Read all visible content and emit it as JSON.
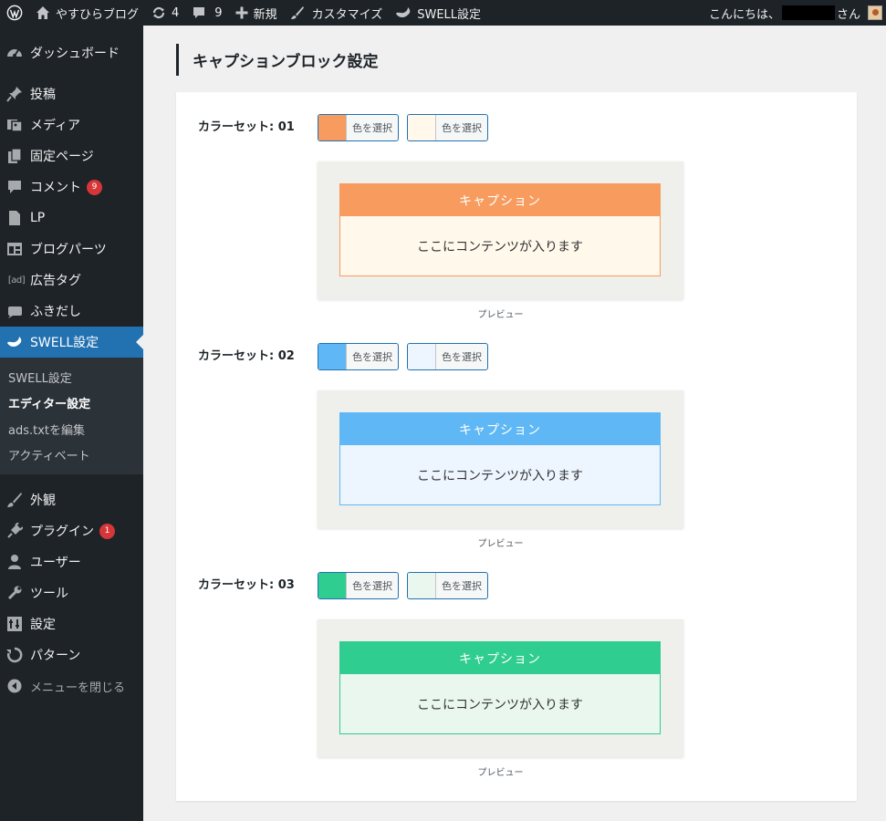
{
  "adminbar": {
    "site_name": "やすひらブログ",
    "updates_count": "4",
    "comments_count": "9",
    "new_label": "新規",
    "customize_label": "カスタマイズ",
    "swell_label": "SWELL設定",
    "greeting_prefix": "こんにちは、",
    "greeting_suffix": "さん"
  },
  "sidebar": {
    "items_top": [
      {
        "label": "ダッシュボード",
        "icon": "dashboard-icon"
      },
      {
        "label": "投稿",
        "icon": "pin-icon"
      },
      {
        "label": "メディア",
        "icon": "media-icon"
      },
      {
        "label": "固定ページ",
        "icon": "page-icon"
      },
      {
        "label": "コメント",
        "icon": "comment-icon",
        "badge": "9"
      },
      {
        "label": "LP",
        "icon": "lp-icon"
      },
      {
        "label": "ブログパーツ",
        "icon": "blog-parts-icon"
      },
      {
        "label": "広告タグ",
        "icon": "ad-icon",
        "icon_text": "[ad]"
      },
      {
        "label": "ふきだし",
        "icon": "balloon-icon"
      },
      {
        "label": "SWELL設定",
        "icon": "swell-icon"
      }
    ],
    "submenu": [
      "SWELL設定",
      "エディター設定",
      "ads.txtを編集",
      "アクティベート"
    ],
    "items_bottom": [
      {
        "label": "外観",
        "icon": "brush-icon"
      },
      {
        "label": "プラグイン",
        "icon": "plugin-icon",
        "badge": "1"
      },
      {
        "label": "ユーザー",
        "icon": "user-icon"
      },
      {
        "label": "ツール",
        "icon": "wrench-icon"
      },
      {
        "label": "設定",
        "icon": "settings-icon"
      },
      {
        "label": "パターン",
        "icon": "pattern-icon"
      }
    ],
    "collapse_label": "メニューを閉じる"
  },
  "main": {
    "title": "キャプションブロック設定",
    "color_button_label": "色を選択",
    "sets": [
      {
        "label": "カラーセット: 01",
        "color1": "#f79b5e",
        "color2": "#fff8eb",
        "caption": "キャプション",
        "content": "ここにコンテンツが入ります",
        "preview": "プレビュー"
      },
      {
        "label": "カラーセット: 02",
        "color1": "#5fb8f5",
        "color2": "#edf5ff",
        "caption": "キャプション",
        "content": "ここにコンテンツが入ります",
        "preview": "プレビュー"
      },
      {
        "label": "カラーセット: 03",
        "color1": "#2fcd90",
        "color2": "#eaf7ef",
        "caption": "キャプション",
        "content": "ここにコンテンツが入ります",
        "preview": "プレビュー"
      }
    ]
  }
}
